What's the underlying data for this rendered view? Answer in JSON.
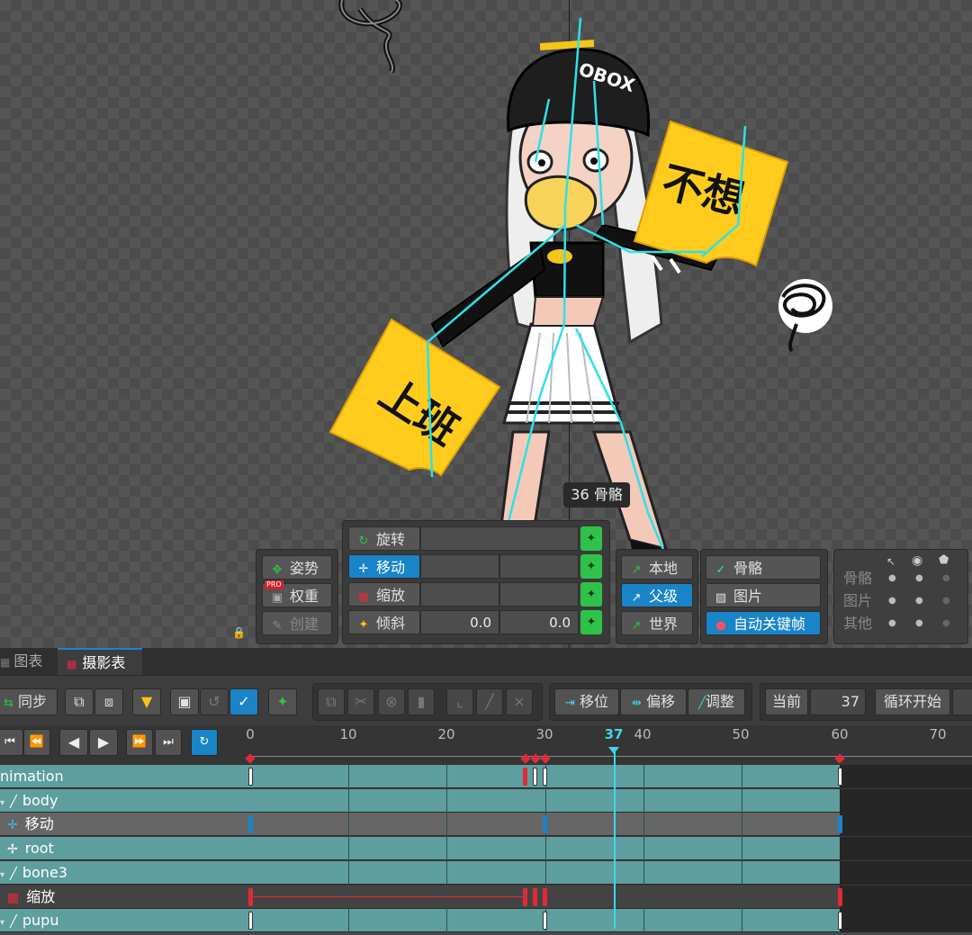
{
  "overlay": {
    "bone_tooltip": "36 骨骼"
  },
  "artwork": {
    "sign_left": "上班",
    "sign_right": "不想",
    "hat_text": "OBOX"
  },
  "pose_panel": {
    "pose": "姿势",
    "weight": "权重",
    "weight_badge": "PRO",
    "create": "创建"
  },
  "transform_panel": {
    "rotate": "旋转",
    "translate": "移动",
    "scale": "缩放",
    "shear": "倾斜",
    "shear_x": "0.0",
    "shear_y": "0.0"
  },
  "axes_panel": {
    "local": "本地",
    "parent": "父级",
    "world": "世界"
  },
  "key_panel": {
    "bones": "骨骼",
    "images": "图片",
    "auto_key": "自动关键帧"
  },
  "visibility_panel": {
    "rows": [
      "骨骼",
      "图片",
      "其他"
    ]
  },
  "tabs": [
    {
      "label": "图表"
    },
    {
      "label": "摄影表"
    }
  ],
  "toolbar": {
    "sync": "同步",
    "offset_frames": "移位",
    "offset": "偏移",
    "adjust": "调整",
    "current_label": "当前",
    "current_value": "37",
    "loop_start": "循环开始"
  },
  "ruler": {
    "ticks": [
      "0",
      "10",
      "20",
      "30",
      "37",
      "40",
      "50",
      "60",
      "70"
    ],
    "current": "37"
  },
  "tree": {
    "rows": [
      {
        "label": "nimation"
      },
      {
        "label": "body"
      },
      {
        "label": "移动"
      },
      {
        "label": "root"
      },
      {
        "label": "bone3"
      },
      {
        "label": "缩放"
      },
      {
        "label": "pupu"
      }
    ]
  },
  "colors": {
    "accent": "#1a84c8",
    "key_green": "#2fc24a",
    "track": "#5e9e9e",
    "keyframe_red": "#e02a3a"
  }
}
